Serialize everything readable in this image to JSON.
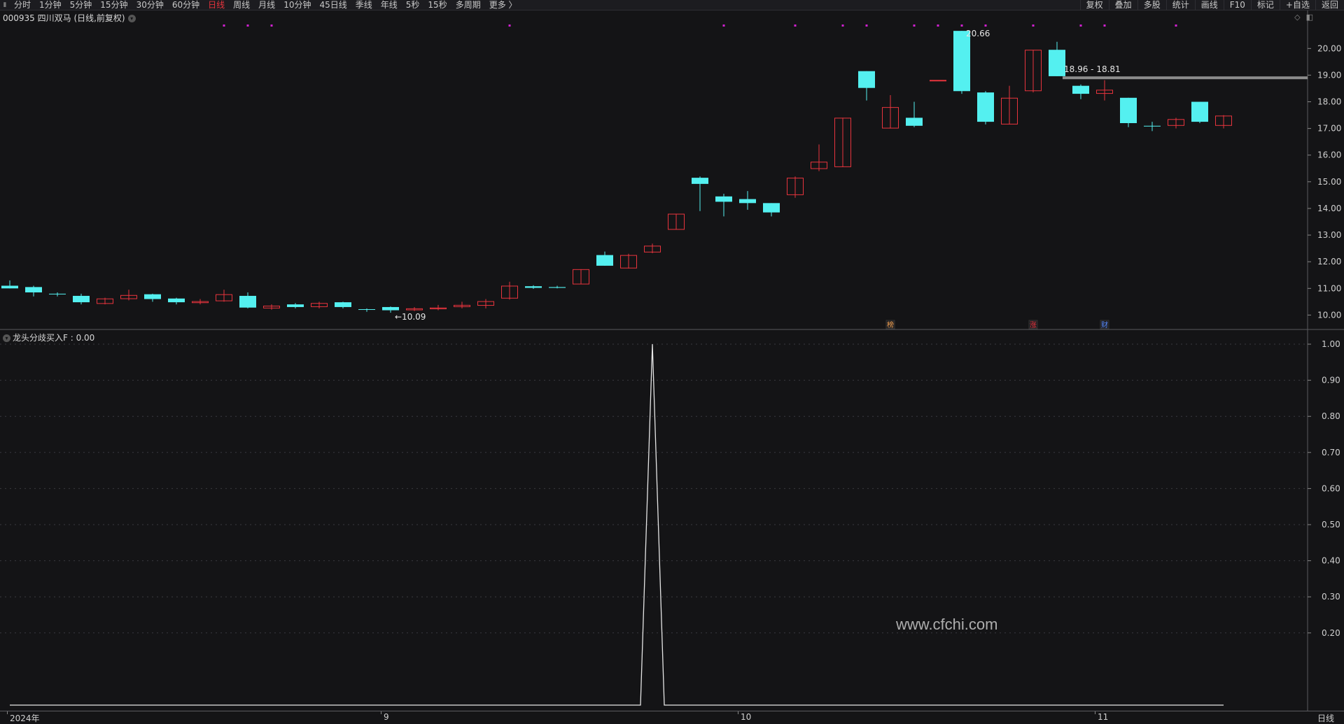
{
  "toolbar": {
    "periods": [
      "分时",
      "1分钟",
      "5分钟",
      "15分钟",
      "30分钟",
      "60分钟",
      "日线",
      "周线",
      "月线",
      "10分钟",
      "45日线",
      "季线",
      "年线",
      "5秒",
      "15秒",
      "多周期",
      "更多 〉"
    ],
    "active_period": "日线",
    "right_tools": [
      "复权",
      "叠加",
      "多股",
      "统计",
      "画线",
      "F10",
      "标记",
      "+自选",
      "返回"
    ]
  },
  "stock": {
    "title": "000935 四川双马 (日线,前复权)"
  },
  "price_axis": [
    "20.00",
    "19.00",
    "18.00",
    "17.00",
    "16.00",
    "15.00",
    "14.00",
    "13.00",
    "12.00",
    "11.00",
    "10.00"
  ],
  "annotations": {
    "high_label": "20.66",
    "low_label": "←10.09",
    "range_label": "18.96 - 18.81"
  },
  "event_badges": [
    {
      "text": "榜",
      "color": "#f0a050"
    },
    {
      "text": "涨",
      "color": "#e8343d"
    },
    {
      "text": "财",
      "color": "#5a8cff"
    }
  ],
  "indicator": {
    "title": "龙头分歧买入F : 0.00",
    "axis": [
      "1.00",
      "0.90",
      "0.80",
      "0.70",
      "0.60",
      "0.50",
      "0.40",
      "0.30",
      "0.20"
    ]
  },
  "time_axis": {
    "labels": [
      "2024年",
      "9",
      "10",
      "11"
    ],
    "period_label": "日线"
  },
  "watermark": "www.cfchi.com",
  "colors": {
    "up": "#e8343d",
    "down": "#54f0f0",
    "grid": "#3a3a40",
    "line": "#e6e6e6",
    "marker": "#d020d0"
  },
  "chart_data": {
    "type": "candlestick",
    "candles": [
      {
        "o": 11.1,
        "c": 11.0,
        "h": 11.3,
        "l": 11.0
      },
      {
        "o": 11.05,
        "c": 10.85,
        "h": 11.1,
        "l": 10.7
      },
      {
        "o": 10.8,
        "c": 10.78,
        "h": 10.85,
        "l": 10.7
      },
      {
        "o": 10.72,
        "c": 10.48,
        "h": 10.8,
        "l": 10.4
      },
      {
        "o": 10.42,
        "c": 10.62,
        "h": 10.65,
        "l": 10.4
      },
      {
        "o": 10.6,
        "c": 10.75,
        "h": 10.95,
        "l": 10.55
      },
      {
        "o": 10.78,
        "c": 10.6,
        "h": 10.8,
        "l": 10.5
      },
      {
        "o": 10.62,
        "c": 10.48,
        "h": 10.65,
        "l": 10.4
      },
      {
        "o": 10.45,
        "c": 10.52,
        "h": 10.6,
        "l": 10.4
      },
      {
        "o": 10.52,
        "c": 10.78,
        "h": 10.95,
        "l": 10.5
      },
      {
        "o": 10.72,
        "c": 10.28,
        "h": 10.85,
        "l": 10.25
      },
      {
        "o": 10.25,
        "c": 10.35,
        "h": 10.4,
        "l": 10.2
      },
      {
        "o": 10.4,
        "c": 10.3,
        "h": 10.45,
        "l": 10.25
      },
      {
        "o": 10.3,
        "c": 10.45,
        "h": 10.5,
        "l": 10.25
      },
      {
        "o": 10.48,
        "c": 10.3,
        "h": 10.5,
        "l": 10.25
      },
      {
        "o": 10.22,
        "c": 10.2,
        "h": 10.25,
        "l": 10.12
      },
      {
        "o": 10.3,
        "c": 10.18,
        "h": 10.32,
        "l": 10.09
      },
      {
        "o": 10.18,
        "c": 10.25,
        "h": 10.3,
        "l": 10.15
      },
      {
        "o": 10.22,
        "c": 10.28,
        "h": 10.38,
        "l": 10.18
      },
      {
        "o": 10.3,
        "c": 10.38,
        "h": 10.5,
        "l": 10.25
      },
      {
        "o": 10.35,
        "c": 10.52,
        "h": 10.6,
        "l": 10.25
      },
      {
        "o": 10.62,
        "c": 11.1,
        "h": 11.25,
        "l": 10.58
      },
      {
        "o": 11.08,
        "c": 11.02,
        "h": 11.12,
        "l": 10.98
      },
      {
        "o": 11.05,
        "c": 11.02,
        "h": 11.1,
        "l": 11.0
      },
      {
        "o": 11.15,
        "c": 11.72,
        "h": 11.72,
        "l": 11.15
      },
      {
        "o": 12.25,
        "c": 11.85,
        "h": 12.38,
        "l": 11.85
      },
      {
        "o": 11.75,
        "c": 12.25,
        "h": 12.3,
        "l": 11.75
      },
      {
        "o": 12.35,
        "c": 12.6,
        "h": 12.68,
        "l": 12.32
      },
      {
        "o": 13.2,
        "c": 13.8,
        "h": 13.8,
        "l": 13.2
      },
      {
        "o": 15.15,
        "c": 14.92,
        "h": 15.2,
        "l": 13.9
      },
      {
        "o": 14.45,
        "c": 14.25,
        "h": 14.55,
        "l": 13.7
      },
      {
        "o": 14.35,
        "c": 14.2,
        "h": 14.65,
        "l": 13.95
      },
      {
        "o": 14.2,
        "c": 13.85,
        "h": 14.2,
        "l": 13.7
      },
      {
        "o": 14.5,
        "c": 15.15,
        "h": 15.2,
        "l": 14.4
      },
      {
        "o": 15.48,
        "c": 15.75,
        "h": 16.4,
        "l": 15.4
      },
      {
        "o": 15.55,
        "c": 17.4,
        "h": 17.4,
        "l": 15.55
      },
      {
        "o": 19.15,
        "c": 18.52,
        "h": 19.15,
        "l": 18.05
      },
      {
        "o": 17.0,
        "c": 17.8,
        "h": 18.25,
        "l": 17.0
      },
      {
        "o": 17.4,
        "c": 17.1,
        "h": 18.0,
        "l": 17.05
      },
      {
        "o": 18.82,
        "c": 18.82,
        "h": 18.82,
        "l": 18.82
      },
      {
        "o": 20.66,
        "c": 18.4,
        "h": 20.66,
        "l": 18.3
      },
      {
        "o": 18.35,
        "c": 17.25,
        "h": 18.4,
        "l": 17.15
      },
      {
        "o": 17.15,
        "c": 18.15,
        "h": 18.6,
        "l": 17.15
      },
      {
        "o": 18.4,
        "c": 19.95,
        "h": 19.95,
        "l": 18.35
      },
      {
        "o": 19.95,
        "c": 18.96,
        "h": 20.25,
        "l": 18.96
      },
      {
        "o": 18.6,
        "c": 18.3,
        "h": 18.65,
        "l": 18.1
      },
      {
        "o": 18.3,
        "c": 18.45,
        "h": 18.81,
        "l": 18.05
      },
      {
        "o": 18.15,
        "c": 17.2,
        "h": 18.15,
        "l": 17.05
      },
      {
        "o": 17.1,
        "c": 17.08,
        "h": 17.25,
        "l": 16.9
      },
      {
        "o": 17.1,
        "c": 17.35,
        "h": 17.4,
        "l": 17.0
      },
      {
        "o": 18.0,
        "c": 17.25,
        "h": 18.0,
        "l": 17.2
      },
      {
        "o": 17.1,
        "c": 17.48,
        "h": 17.5,
        "l": 17.0
      }
    ],
    "signal_markers": [
      9,
      10,
      11,
      21,
      30,
      33,
      35,
      36,
      38,
      39,
      40,
      41,
      43,
      45,
      46,
      49
    ],
    "badge_candles": [
      37,
      43,
      46
    ],
    "indicator_series": [
      0,
      0,
      0,
      0,
      0,
      0,
      0,
      0,
      0,
      0,
      0,
      0,
      0,
      0,
      0,
      0,
      0,
      0,
      0,
      0,
      0,
      0,
      0,
      0,
      0,
      0,
      0,
      1,
      0,
      0,
      0,
      0,
      0,
      0,
      0,
      0,
      0,
      0,
      0,
      0,
      0,
      0,
      0,
      0,
      0,
      0,
      0,
      0,
      0,
      0,
      0,
      0
    ],
    "price_range": [
      9.8,
      20.9
    ],
    "indicator_range": [
      0,
      1.0
    ],
    "range_line_value": 18.9,
    "xlabel": "",
    "ylabel": ""
  }
}
